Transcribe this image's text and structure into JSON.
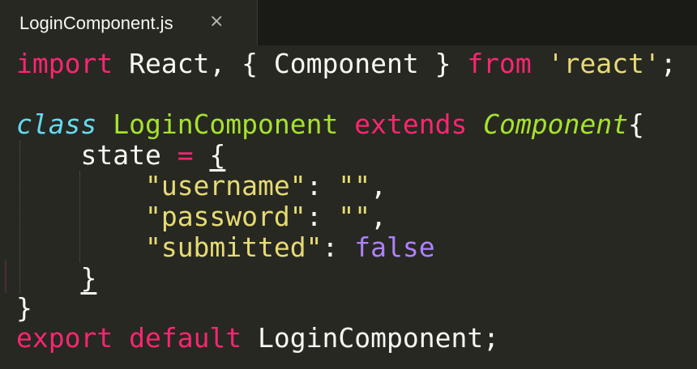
{
  "tab": {
    "title": "LoginComponent.js",
    "close_glyph": "×",
    "close_icon": "close-icon"
  },
  "code": {
    "l1_import": "import",
    "l1_rest": " React, { Component } ",
    "l1_from": "from",
    "l1_space": " ",
    "l1_module": "'react'",
    "l1_semi": ";",
    "l3_class": "class",
    "l3_space": " ",
    "l3_name": "LoginComponent",
    "l3_space2": " ",
    "l3_extends": "extends",
    "l3_space3": " ",
    "l3_parent": "Component",
    "l3_brace": "{",
    "l4_indent": "    ",
    "l4_state": "state ",
    "l4_eq": "=",
    "l4_space": " ",
    "l4_brace": "{",
    "l5_indent": "        ",
    "l5_key": "\"username\"",
    "l5_colon": ": ",
    "l5_val": "\"\"",
    "l5_comma": ",",
    "l6_indent": "        ",
    "l6_key": "\"password\"",
    "l6_colon": ": ",
    "l6_val": "\"\"",
    "l6_comma": ",",
    "l7_indent": "        ",
    "l7_key": "\"submitted\"",
    "l7_colon": ": ",
    "l7_val": "false",
    "l8_indent": "    ",
    "l8_brace": "}",
    "l9_brace": "}",
    "l10_export": "export",
    "l10_space": " ",
    "l10_default": "default",
    "l10_rest": " LoginComponent;"
  },
  "colors": {
    "background": "#272822",
    "keyword": "#f92672",
    "string": "#e6db74",
    "storage_italic": "#66d9ef",
    "class_name": "#a6e22e",
    "constant": "#ae81ff",
    "text": "#f8f8f2"
  }
}
